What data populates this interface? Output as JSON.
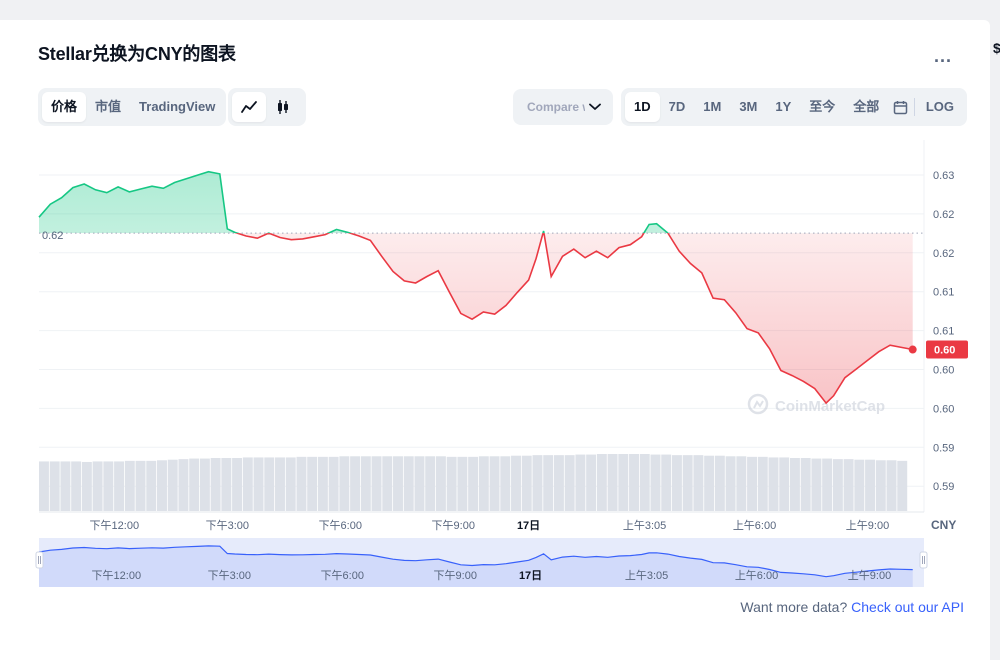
{
  "title": "Stellar兑换为CNY的图表",
  "more_label": "...",
  "edge_glyph": "$",
  "tabs": {
    "view": [
      {
        "label": "价格",
        "active": true
      },
      {
        "label": "市值",
        "active": false
      },
      {
        "label": "TradingView",
        "active": false
      }
    ],
    "chart_types": [
      {
        "icon": "line-chart-icon",
        "active": true
      },
      {
        "icon": "candlestick-icon",
        "active": false
      }
    ],
    "compare": {
      "label": "Compare with"
    },
    "ranges": [
      {
        "label": "1D",
        "active": true
      },
      {
        "label": "7D",
        "active": false
      },
      {
        "label": "1M",
        "active": false
      },
      {
        "label": "3M",
        "active": false
      },
      {
        "label": "1Y",
        "active": false
      },
      {
        "label": "至今",
        "active": false
      },
      {
        "label": "全部",
        "active": false
      }
    ],
    "calendar_icon": "calendar-icon",
    "log_label": "LOG"
  },
  "chart_data": {
    "type": "line",
    "currency": "CNY",
    "open_price_label": "0.62",
    "current_price_label": "0.60",
    "y_tick_labels": [
      "0.63",
      "0.62",
      "0.62",
      "0.61",
      "0.61",
      "0.60",
      "0.60",
      "0.59",
      "0.59"
    ],
    "x_tick_labels": [
      "下午12:00",
      "下午3:00",
      "下午6:00",
      "下午9:00",
      "17日",
      "上午3:05",
      "上午6:00",
      "上午9:00"
    ],
    "navigator_tick_labels": [
      "下午12:00",
      "下午3:00",
      "下午6:00",
      "下午9:00",
      "17日",
      "上午3:05",
      "上午6:00",
      "上午9:00"
    ],
    "ylim": [
      0.5889,
      0.6315
    ],
    "open_price": 0.62,
    "x_range_hours": [
      0,
      23.5
    ],
    "x_tick_hours": [
      2,
      5,
      8,
      11,
      13,
      16.08,
      19,
      22
    ],
    "x_tick_bold": [
      false,
      false,
      false,
      false,
      true,
      false,
      false,
      false
    ],
    "up_color": "#16c784",
    "down_color": "#ea3943",
    "navigator_color": "#3861fb",
    "watermark": "CoinMarketCap",
    "series": [
      {
        "x": [
          0.0,
          0.3,
          0.6,
          0.9,
          1.2,
          1.5,
          1.8,
          2.1,
          2.4,
          2.7,
          3.0,
          3.3,
          3.6,
          3.9,
          4.2,
          4.5,
          4.8,
          5.0,
          5.2,
          5.5,
          5.8,
          6.1,
          6.4,
          6.7,
          7.0,
          7.3,
          7.6,
          7.9,
          8.2,
          8.5,
          8.8,
          9.1,
          9.4,
          9.7,
          10.0,
          10.3,
          10.6,
          10.9,
          11.2,
          11.5,
          11.8,
          12.1,
          12.4,
          12.7,
          13.0,
          13.2,
          13.4,
          13.6,
          13.9,
          14.2,
          14.5,
          14.8,
          15.1,
          15.4,
          15.7,
          16.0,
          16.2,
          16.4,
          16.7,
          17.0,
          17.3,
          17.6,
          17.9,
          18.2,
          18.5,
          18.8,
          19.1,
          19.4,
          19.7,
          20.0,
          20.3,
          20.6,
          20.9,
          21.1,
          21.4,
          21.7,
          22.0,
          22.3,
          22.6,
          22.9,
          23.2
        ],
        "y": [
          0.6222,
          0.624,
          0.6249,
          0.6263,
          0.6268,
          0.626,
          0.6256,
          0.6264,
          0.6257,
          0.6261,
          0.6265,
          0.6262,
          0.627,
          0.6275,
          0.628,
          0.6285,
          0.6282,
          0.6206,
          0.6201,
          0.6196,
          0.6193,
          0.62,
          0.6194,
          0.6191,
          0.6192,
          0.6195,
          0.6198,
          0.6205,
          0.6201,
          0.6196,
          0.619,
          0.6168,
          0.6147,
          0.6134,
          0.6131,
          0.614,
          0.6148,
          0.6118,
          0.6089,
          0.6081,
          0.6091,
          0.6088,
          0.61,
          0.6118,
          0.6135,
          0.6165,
          0.6203,
          0.614,
          0.6168,
          0.6178,
          0.6166,
          0.6175,
          0.6166,
          0.618,
          0.6184,
          0.6195,
          0.6212,
          0.6213,
          0.62,
          0.6175,
          0.6158,
          0.6145,
          0.611,
          0.6108,
          0.609,
          0.6068,
          0.6062,
          0.604,
          0.601,
          0.6003,
          0.5995,
          0.5985,
          0.5965,
          0.5975,
          0.6,
          0.6012,
          0.6024,
          0.6036,
          0.6045,
          0.6042,
          0.6039
        ]
      }
    ],
    "volume": [
      0.87,
      0.87,
      0.87,
      0.87,
      0.86,
      0.87,
      0.87,
      0.87,
      0.88,
      0.88,
      0.88,
      0.89,
      0.9,
      0.91,
      0.92,
      0.92,
      0.93,
      0.93,
      0.93,
      0.94,
      0.94,
      0.94,
      0.94,
      0.94,
      0.95,
      0.95,
      0.95,
      0.95,
      0.96,
      0.96,
      0.96,
      0.96,
      0.96,
      0.96,
      0.96,
      0.96,
      0.96,
      0.96,
      0.95,
      0.95,
      0.95,
      0.96,
      0.96,
      0.96,
      0.97,
      0.97,
      0.98,
      0.98,
      0.98,
      0.98,
      0.99,
      0.99,
      1.0,
      1.0,
      1.0,
      1.0,
      1.0,
      0.99,
      0.99,
      0.98,
      0.98,
      0.98,
      0.97,
      0.97,
      0.96,
      0.96,
      0.95,
      0.95,
      0.94,
      0.94,
      0.93,
      0.93,
      0.92,
      0.92,
      0.91,
      0.91,
      0.9,
      0.9,
      0.89,
      0.89,
      0.88
    ]
  },
  "footer": {
    "prefix": "Want more data?",
    "link": "Check out our API"
  }
}
